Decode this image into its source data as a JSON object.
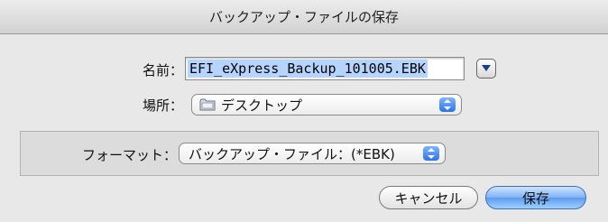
{
  "window": {
    "title": "バックアップ・ファイルの保存"
  },
  "name_field": {
    "label": "名前：",
    "value": "EFI_eXpress_Backup_101005.EBK"
  },
  "location": {
    "label": "場所：",
    "value": "デスクトップ",
    "icon": "folder-icon"
  },
  "format": {
    "label": "フォーマット：",
    "value": "バックアップ・ファイル：(*EBK)"
  },
  "buttons": {
    "cancel": "キャンセル",
    "save": "保存"
  },
  "colors": {
    "selection": "#b5d5ff",
    "accent": "#2d73e8"
  }
}
